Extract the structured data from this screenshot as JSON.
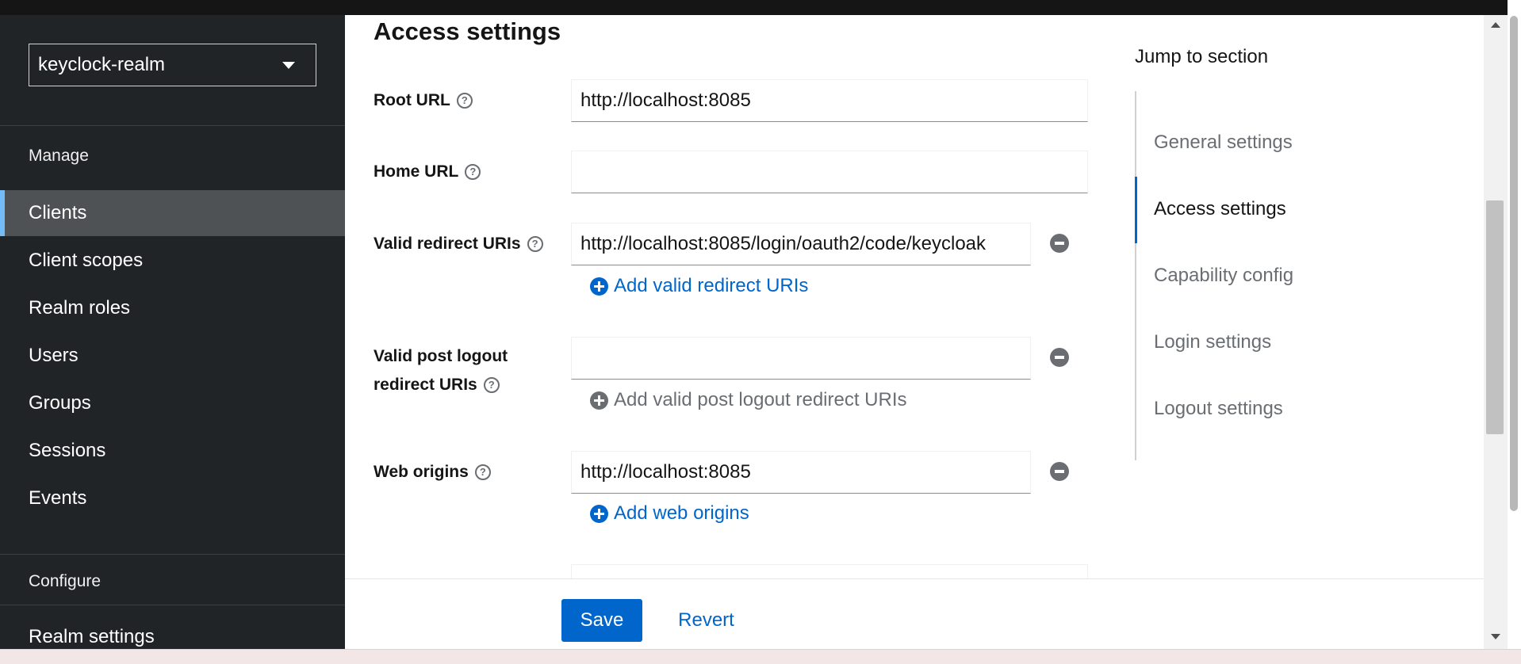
{
  "sidebar": {
    "realm": "keyclock-realm",
    "manage_heading": "Manage",
    "items": [
      {
        "label": "Clients"
      },
      {
        "label": "Client scopes"
      },
      {
        "label": "Realm roles"
      },
      {
        "label": "Users"
      },
      {
        "label": "Groups"
      },
      {
        "label": "Sessions"
      },
      {
        "label": "Events"
      }
    ],
    "configure_heading": "Configure",
    "configure_items": [
      {
        "label": "Realm settings"
      }
    ],
    "active_item": "Clients"
  },
  "main": {
    "section_title": "Access settings",
    "fields": {
      "root_url": {
        "label": "Root URL",
        "value": "http://localhost:8085"
      },
      "home_url": {
        "label": "Home URL",
        "value": ""
      },
      "valid_redirect_uris": {
        "label": "Valid redirect URIs",
        "value": "http://localhost:8085/login/oauth2/code/keycloak",
        "add_label": "Add valid redirect URIs"
      },
      "valid_post_logout": {
        "label_line1": "Valid post logout",
        "label_line2": "redirect URIs",
        "value": "",
        "add_label": "Add valid post logout redirect URIs"
      },
      "web_origins": {
        "label": "Web origins",
        "value": "http://localhost:8085",
        "add_label": "Add web origins"
      }
    }
  },
  "jump": {
    "title": "Jump to section",
    "items": [
      {
        "label": "General settings"
      },
      {
        "label": "Access settings"
      },
      {
        "label": "Capability config"
      },
      {
        "label": "Login settings"
      },
      {
        "label": "Logout settings"
      }
    ],
    "active": "Access settings"
  },
  "footer": {
    "save_label": "Save",
    "revert_label": "Revert"
  },
  "colors": {
    "sidebar_bg": "#212427",
    "active_nav_bg": "#4f5255",
    "active_accent": "#73bcf7",
    "primary": "#0066cc"
  }
}
